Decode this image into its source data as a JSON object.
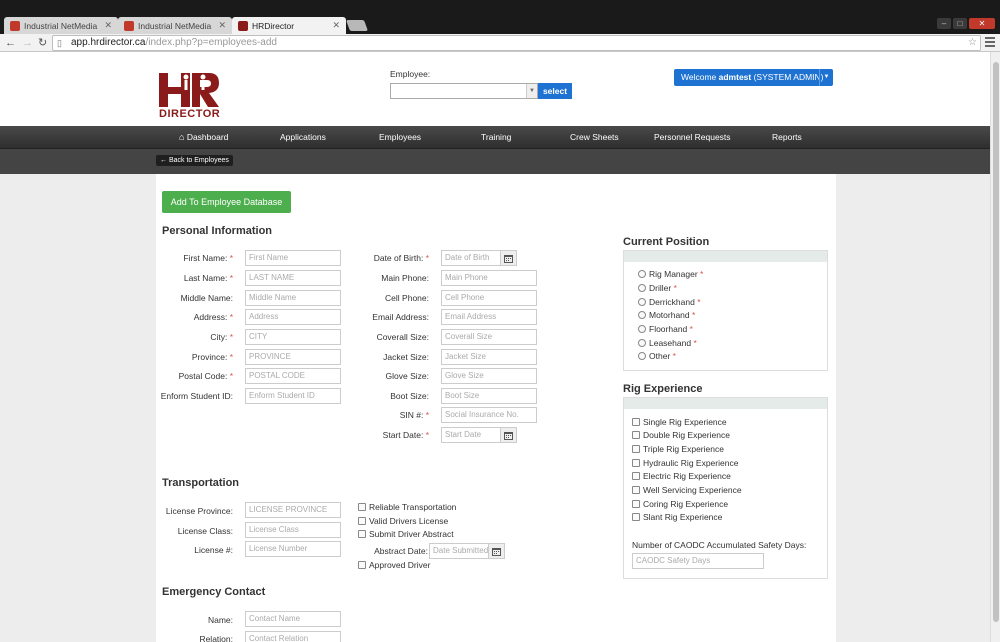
{
  "browser": {
    "tabs": [
      {
        "title": "Industrial NetMedia"
      },
      {
        "title": "Industrial NetMedia"
      },
      {
        "title": "HRDirector"
      }
    ],
    "url_host": "app.hrdirector.ca",
    "url_path": "/index.php?p=employees-add"
  },
  "header": {
    "logo_letters": "HR",
    "logo_word": "DIRECTOR",
    "employee_label": "Employee:",
    "select_button": "select",
    "welcome_prefix": "Welcome ",
    "welcome_user": "admtest",
    "welcome_suffix": " (SYSTEM ADMIN)"
  },
  "nav": {
    "items": [
      "Dashboard",
      "Applications",
      "Employees",
      "Training",
      "Crew Sheets",
      "Personnel Requests",
      "Reports"
    ]
  },
  "back_button": "Back to Employees",
  "add_button": "Add To Employee Database",
  "personal": {
    "heading": "Personal Information",
    "first_name": {
      "label": "First Name:",
      "placeholder": "First Name"
    },
    "last_name": {
      "label": "Last Name:",
      "placeholder": "LAST NAME"
    },
    "middle_name": {
      "label": "Middle Name:",
      "placeholder": "Middle Name"
    },
    "address": {
      "label": "Address:",
      "placeholder": "Address"
    },
    "city": {
      "label": "City:",
      "placeholder": "CITY"
    },
    "province": {
      "label": "Province:",
      "placeholder": "PROVINCE"
    },
    "postal": {
      "label": "Postal Code:",
      "placeholder": "POSTAL CODE"
    },
    "enform": {
      "label": "Enform Student ID:",
      "placeholder": "Enform Student ID"
    },
    "dob": {
      "label": "Date of Birth:",
      "placeholder": "Date of Birth"
    },
    "main_phone": {
      "label": "Main Phone:",
      "placeholder": "Main Phone"
    },
    "cell_phone": {
      "label": "Cell Phone:",
      "placeholder": "Cell Phone"
    },
    "email": {
      "label": "Email Address:",
      "placeholder": "Email Address"
    },
    "coverall": {
      "label": "Coverall Size:",
      "placeholder": "Coverall Size"
    },
    "jacket": {
      "label": "Jacket Size:",
      "placeholder": "Jacket Size"
    },
    "glove": {
      "label": "Glove Size:",
      "placeholder": "Glove Size"
    },
    "boot": {
      "label": "Boot Size:",
      "placeholder": "Boot Size"
    },
    "sin": {
      "label": "SIN #:",
      "placeholder": "Social Insurance No."
    },
    "start_date": {
      "label": "Start Date:",
      "placeholder": "Start Date"
    }
  },
  "transportation": {
    "heading": "Transportation",
    "license_province": {
      "label": "License Province:",
      "placeholder": "LICENSE PROVINCE"
    },
    "license_class": {
      "label": "License Class:",
      "placeholder": "License Class"
    },
    "license_number": {
      "label": "License #:",
      "placeholder": "License Number"
    },
    "checkboxes": [
      "Reliable Transportation",
      "Valid Drivers License",
      "Submit Driver Abstract"
    ],
    "abstract_date": {
      "label": "Abstract Date:",
      "placeholder": "Date Submitted"
    },
    "approved_driver": "Approved Driver"
  },
  "emergency": {
    "heading": "Emergency Contact",
    "name": {
      "label": "Name:",
      "placeholder": "Contact Name"
    },
    "relation": {
      "label": "Relation:",
      "placeholder": "Contact Relation"
    }
  },
  "current_position": {
    "heading": "Current Position",
    "options": [
      "Rig Manager",
      "Driller",
      "Derrickhand",
      "Motorhand",
      "Floorhand",
      "Leasehand",
      "Other"
    ]
  },
  "rig_experience": {
    "heading": "Rig Experience",
    "options": [
      "Single Rig Experience",
      "Double Rig Experience",
      "Triple Rig Experience",
      "Hydraulic Rig Experience",
      "Electric Rig Experience",
      "Well Servicing Experience",
      "Coring Rig Experience",
      "Slant Rig Experience"
    ],
    "safety_label": "Number of CAODC Accumulated Safety Days:",
    "safety_placeholder": "CAODC Safety Days"
  },
  "colors": {
    "brand_red": "#8b1a1a",
    "accent_blue": "#1e73d2",
    "button_green": "#4cae4c",
    "nav_dark": "#333333"
  }
}
